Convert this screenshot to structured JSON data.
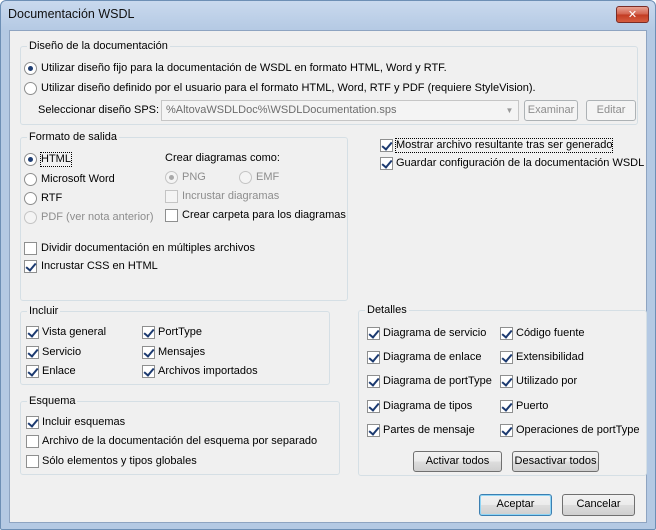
{
  "window": {
    "title": "Documentación WSDL",
    "close_glyph": "✕"
  },
  "design": {
    "legend": "Diseño de la documentación",
    "option_fixed": "Utilizar diseño fijo para la documentación de WSDL en formato HTML, Word y RTF.",
    "option_user": "Utilizar diseño definido por el usuario para el formato HTML, Word, RTF y PDF (requiere StyleVision).",
    "sps_label": "Seleccionar diseño SPS:",
    "sps_value": "%AltovaWSDLDoc%\\WSDLDocumentation.sps",
    "browse_button": "Examinar",
    "edit_button": "Editar"
  },
  "output": {
    "legend": "Formato de salida",
    "formats": [
      "HTML",
      "Microsoft Word",
      "RTF",
      "PDF (ver nota anterior)"
    ],
    "selected_format": "HTML",
    "diagrams_title": "Crear diagramas como:",
    "diagram_png": "PNG",
    "diagram_emf": "EMF",
    "embed_diagrams": "Incrustar diagramas",
    "create_folder": "Crear carpeta para los diagramas",
    "split_docs": "Dividir documentación en múltiples archivos",
    "embed_css": "Incrustar CSS en HTML"
  },
  "options": {
    "show_result": "Mostrar archivo resultante tras ser generado",
    "save_config": "Guardar configuración de la documentación WSDL"
  },
  "include": {
    "legend": "Incluir",
    "items": [
      "Vista general",
      "Servicio",
      "Enlace",
      "PortType",
      "Mensajes",
      "Archivos importados"
    ]
  },
  "schema": {
    "legend": "Esquema",
    "items": [
      "Incluir esquemas",
      "Archivo de la documentación del esquema por separado",
      "Sólo elementos y tipos globales"
    ]
  },
  "details": {
    "legend": "Detalles",
    "left_items": [
      "Diagrama de servicio",
      "Diagrama de enlace",
      "Diagrama de portType",
      "Diagrama de tipos",
      "Partes de mensaje"
    ],
    "right_items": [
      "Código fuente",
      "Extensibilidad",
      "Utilizado por",
      "Puerto",
      "Operaciones de portType"
    ],
    "activate_all": "Activar todos",
    "deactivate_all": "Desactivar todos"
  },
  "footer": {
    "ok": "Aceptar",
    "cancel": "Cancelar"
  },
  "colors": {
    "title_gradient": "#c9d9ee",
    "client_bg": "#f0f0f0",
    "close_red": "#c23b22"
  }
}
